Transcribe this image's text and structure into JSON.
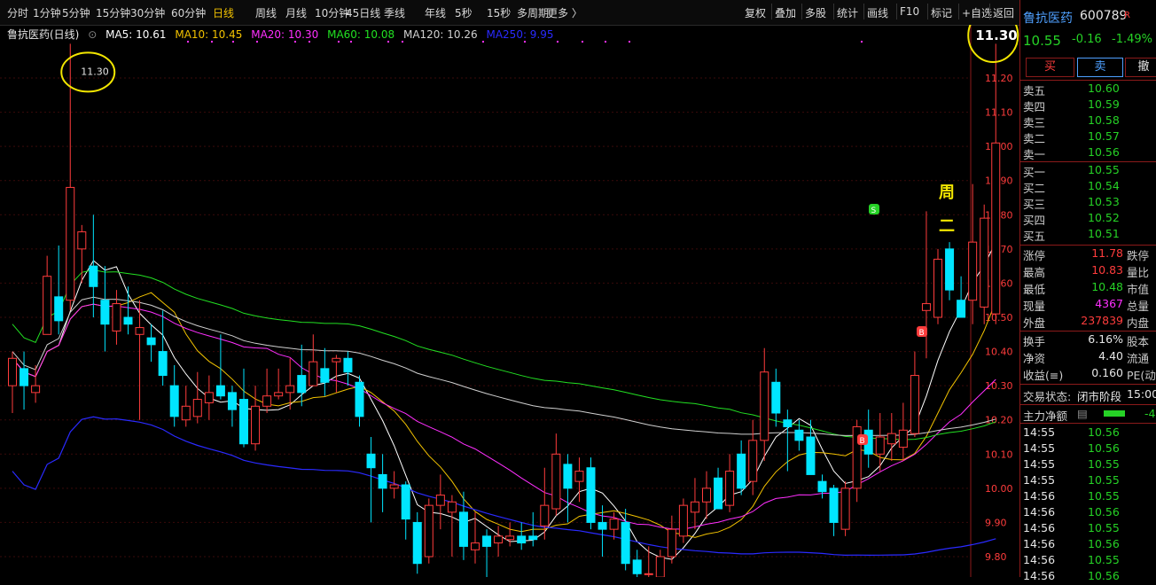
{
  "toolbar": {
    "periods": [
      "分时",
      "1分钟",
      "5分钟",
      "15分钟",
      "30分钟",
      "60分钟",
      "日线",
      "周线",
      "月线",
      "10分钟",
      "45日线",
      "季线",
      "年线",
      "5秒",
      "15秒",
      "多周期",
      "更多 〉"
    ],
    "active_period": "日线",
    "tools": [
      "复权",
      "叠加",
      "多股",
      "统计",
      "画线",
      "F10",
      "标记",
      "+自选",
      "返回"
    ]
  },
  "legend": {
    "title": "鲁抗医药(日线)",
    "ma": [
      {
        "label": "MA5: 10.61",
        "color": "#ffffff"
      },
      {
        "label": "MA10: 10.45",
        "color": "#f2c200"
      },
      {
        "label": "MA20: 10.30",
        "color": "#ff2fff"
      },
      {
        "label": "MA60: 10.08",
        "color": "#22e022"
      },
      {
        "label": "MA120: 10.26",
        "color": "#d0d0d0"
      },
      {
        "label": "MA250: 9.95",
        "color": "#2a2aff"
      }
    ]
  },
  "annotations": {
    "left_high_label": "11.30",
    "right_high_label": "11.30",
    "weekday_text": [
      "周",
      "二"
    ]
  },
  "colors": {
    "up": "#ff3c3c",
    "down": "#00e5ff",
    "grid": "#3a0a0a",
    "highlight": "#f2e600"
  },
  "chart_data": {
    "type": "candlestick",
    "price_axis": {
      "min": 9.8,
      "max": 11.2,
      "ticks": [
        "11.20",
        "11.10",
        "11.00",
        "10.90",
        "10.80",
        "10.70",
        "10.60",
        "10.50",
        "10.40",
        "10.30",
        "10.20",
        "10.10",
        "10.00",
        "9.90",
        "9.80"
      ]
    },
    "candles": [
      {
        "o": 10.3,
        "h": 10.4,
        "l": 10.22,
        "c": 10.38
      },
      {
        "o": 10.35,
        "h": 10.4,
        "l": 10.23,
        "c": 10.3
      },
      {
        "o": 10.28,
        "h": 10.36,
        "l": 10.25,
        "c": 10.3
      },
      {
        "o": 10.45,
        "h": 10.68,
        "l": 10.45,
        "c": 10.62
      },
      {
        "o": 10.56,
        "h": 10.71,
        "l": 10.45,
        "c": 10.49
      },
      {
        "o": 10.55,
        "h": 11.3,
        "l": 10.52,
        "c": 10.88
      },
      {
        "o": 10.7,
        "h": 10.77,
        "l": 10.6,
        "c": 10.75
      },
      {
        "o": 10.65,
        "h": 10.8,
        "l": 10.5,
        "c": 10.59
      },
      {
        "o": 10.55,
        "h": 10.65,
        "l": 10.4,
        "c": 10.48
      },
      {
        "o": 10.46,
        "h": 10.58,
        "l": 10.42,
        "c": 10.54
      },
      {
        "o": 10.5,
        "h": 10.59,
        "l": 10.45,
        "c": 10.48
      },
      {
        "o": 10.45,
        "h": 10.55,
        "l": 10.2,
        "c": 10.47
      },
      {
        "o": 10.44,
        "h": 10.48,
        "l": 10.37,
        "c": 10.42
      },
      {
        "o": 10.4,
        "h": 10.52,
        "l": 10.3,
        "c": 10.33
      },
      {
        "o": 10.3,
        "h": 10.36,
        "l": 10.18,
        "c": 10.21
      },
      {
        "o": 10.2,
        "h": 10.3,
        "l": 10.18,
        "c": 10.24
      },
      {
        "o": 10.21,
        "h": 10.34,
        "l": 10.19,
        "c": 10.26
      },
      {
        "o": 10.25,
        "h": 10.33,
        "l": 10.2,
        "c": 10.28
      },
      {
        "o": 10.3,
        "h": 10.45,
        "l": 10.26,
        "c": 10.27
      },
      {
        "o": 10.28,
        "h": 10.3,
        "l": 10.18,
        "c": 10.23
      },
      {
        "o": 10.26,
        "h": 10.35,
        "l": 10.12,
        "c": 10.13
      },
      {
        "o": 10.13,
        "h": 10.3,
        "l": 10.11,
        "c": 10.24
      },
      {
        "o": 10.24,
        "h": 10.35,
        "l": 10.22,
        "c": 10.27
      },
      {
        "o": 10.27,
        "h": 10.35,
        "l": 10.26,
        "c": 10.28
      },
      {
        "o": 10.28,
        "h": 10.38,
        "l": 10.23,
        "c": 10.3
      },
      {
        "o": 10.33,
        "h": 10.42,
        "l": 10.24,
        "c": 10.28
      },
      {
        "o": 10.3,
        "h": 10.45,
        "l": 10.3,
        "c": 10.37
      },
      {
        "o": 10.35,
        "h": 10.41,
        "l": 10.27,
        "c": 10.31
      },
      {
        "o": 10.37,
        "h": 10.39,
        "l": 10.28,
        "c": 10.38
      },
      {
        "o": 10.38,
        "h": 10.4,
        "l": 10.3,
        "c": 10.34
      },
      {
        "o": 10.31,
        "h": 10.33,
        "l": 10.18,
        "c": 10.21
      },
      {
        "o": 10.1,
        "h": 10.15,
        "l": 9.9,
        "c": 10.06
      },
      {
        "o": 10.04,
        "h": 10.1,
        "l": 9.93,
        "c": 10.0
      },
      {
        "o": 10.0,
        "h": 10.05,
        "l": 9.97,
        "c": 10.01
      },
      {
        "o": 10.01,
        "h": 10.02,
        "l": 9.85,
        "c": 9.91
      },
      {
        "o": 9.9,
        "h": 9.93,
        "l": 9.75,
        "c": 9.78
      },
      {
        "o": 9.8,
        "h": 9.97,
        "l": 9.78,
        "c": 9.95
      },
      {
        "o": 9.95,
        "h": 10.04,
        "l": 9.88,
        "c": 9.98
      },
      {
        "o": 9.93,
        "h": 9.98,
        "l": 9.8,
        "c": 9.96
      },
      {
        "o": 9.93,
        "h": 9.99,
        "l": 9.79,
        "c": 9.83
      },
      {
        "o": 9.82,
        "h": 9.93,
        "l": 9.78,
        "c": 9.84
      },
      {
        "o": 9.86,
        "h": 9.88,
        "l": 9.7,
        "c": 9.83
      },
      {
        "o": 9.84,
        "h": 9.89,
        "l": 9.8,
        "c": 9.86
      },
      {
        "o": 9.85,
        "h": 9.9,
        "l": 9.83,
        "c": 9.86
      },
      {
        "o": 9.86,
        "h": 9.9,
        "l": 9.82,
        "c": 9.84
      },
      {
        "o": 9.86,
        "h": 9.93,
        "l": 9.83,
        "c": 9.85
      },
      {
        "o": 9.89,
        "h": 10.06,
        "l": 9.85,
        "c": 9.95
      },
      {
        "o": 9.94,
        "h": 10.16,
        "l": 9.92,
        "c": 10.1
      },
      {
        "o": 10.07,
        "h": 10.1,
        "l": 9.9,
        "c": 10.0
      },
      {
        "o": 10.02,
        "h": 10.09,
        "l": 9.96,
        "c": 10.05
      },
      {
        "o": 10.06,
        "h": 10.09,
        "l": 9.88,
        "c": 9.9
      },
      {
        "o": 9.9,
        "h": 9.95,
        "l": 9.8,
        "c": 9.88
      },
      {
        "o": 9.88,
        "h": 9.93,
        "l": 9.85,
        "c": 9.91
      },
      {
        "o": 9.9,
        "h": 9.94,
        "l": 9.76,
        "c": 9.78
      },
      {
        "o": 9.79,
        "h": 9.82,
        "l": 9.74,
        "c": 9.75
      },
      {
        "o": 9.75,
        "h": 9.83,
        "l": 9.72,
        "c": 9.75
      },
      {
        "o": 9.74,
        "h": 9.82,
        "l": 9.72,
        "c": 9.8
      },
      {
        "o": 9.8,
        "h": 9.92,
        "l": 9.78,
        "c": 9.88
      },
      {
        "o": 9.86,
        "h": 9.97,
        "l": 9.84,
        "c": 9.95
      },
      {
        "o": 9.93,
        "h": 10.03,
        "l": 9.88,
        "c": 9.96
      },
      {
        "o": 9.96,
        "h": 10.05,
        "l": 9.91,
        "c": 10.0
      },
      {
        "o": 10.03,
        "h": 10.06,
        "l": 9.96,
        "c": 9.94
      },
      {
        "o": 9.95,
        "h": 10.1,
        "l": 9.93,
        "c": 10.05
      },
      {
        "o": 10.1,
        "h": 10.14,
        "l": 9.98,
        "c": 10.0
      },
      {
        "o": 10.02,
        "h": 10.2,
        "l": 9.98,
        "c": 10.14
      },
      {
        "o": 10.14,
        "h": 10.41,
        "l": 10.08,
        "c": 10.34
      },
      {
        "o": 10.31,
        "h": 10.35,
        "l": 10.18,
        "c": 10.22
      },
      {
        "o": 10.2,
        "h": 10.23,
        "l": 10.05,
        "c": 10.18
      },
      {
        "o": 10.17,
        "h": 10.2,
        "l": 10.11,
        "c": 10.14
      },
      {
        "o": 10.15,
        "h": 10.2,
        "l": 10.04,
        "c": 10.04
      },
      {
        "o": 10.02,
        "h": 10.04,
        "l": 9.97,
        "c": 9.99
      },
      {
        "o": 10.0,
        "h": 10.01,
        "l": 9.86,
        "c": 9.9
      },
      {
        "o": 9.88,
        "h": 10.02,
        "l": 9.86,
        "c": 10.0
      },
      {
        "o": 10.0,
        "h": 10.2,
        "l": 9.96,
        "c": 10.18
      },
      {
        "o": 10.17,
        "h": 10.23,
        "l": 10.06,
        "c": 10.1
      },
      {
        "o": 10.1,
        "h": 10.22,
        "l": 10.05,
        "c": 10.15
      },
      {
        "o": 10.13,
        "h": 10.22,
        "l": 10.08,
        "c": 10.16
      },
      {
        "o": 10.12,
        "h": 10.25,
        "l": 10.08,
        "c": 10.17
      },
      {
        "o": 10.16,
        "h": 10.4,
        "l": 10.15,
        "c": 10.33
      },
      {
        "o": 10.52,
        "h": 10.81,
        "l": 10.38,
        "c": 10.54
      },
      {
        "o": 10.5,
        "h": 10.7,
        "l": 10.48,
        "c": 10.67
      },
      {
        "o": 10.7,
        "h": 10.72,
        "l": 10.55,
        "c": 10.58
      },
      {
        "o": 10.55,
        "h": 10.62,
        "l": 10.5,
        "c": 10.5
      },
      {
        "o": 10.55,
        "h": 10.89,
        "l": 10.48,
        "c": 10.72
      },
      {
        "o": 10.53,
        "h": 10.83,
        "l": 10.48,
        "c": 10.79
      },
      {
        "o": 10.51,
        "h": 11.3,
        "l": 10.48,
        "c": 11.01
      }
    ]
  },
  "stock_panel": {
    "name": "鲁抗医药",
    "code": "600789",
    "badge": "R",
    "price": "10.55",
    "change": "-0.16",
    "change_pct": "-1.49%",
    "buttons": [
      "买",
      "卖",
      "撤"
    ],
    "sell_levels": [
      {
        "label": "卖五",
        "price": "10.60"
      },
      {
        "label": "卖四",
        "price": "10.59"
      },
      {
        "label": "卖三",
        "price": "10.58"
      },
      {
        "label": "卖二",
        "price": "10.57"
      },
      {
        "label": "卖一",
        "price": "10.56"
      }
    ],
    "buy_levels": [
      {
        "label": "买一",
        "price": "10.55"
      },
      {
        "label": "买二",
        "price": "10.54"
      },
      {
        "label": "买三",
        "price": "10.53"
      },
      {
        "label": "买四",
        "price": "10.52"
      },
      {
        "label": "买五",
        "price": "10.51"
      }
    ],
    "stats": [
      {
        "label": "涨停",
        "value": "11.78",
        "label2": "跌停",
        "color": "#ff3c3c"
      },
      {
        "label": "最高",
        "value": "10.83",
        "label2": "量比",
        "color": "#ff3c3c"
      },
      {
        "label": "最低",
        "value": "10.48",
        "label2": "市值",
        "color": "#26d226"
      },
      {
        "label": "现量",
        "value": "4367",
        "label2": "总量",
        "color": "#ff2fff"
      },
      {
        "label": "外盘",
        "value": "237839",
        "label2": "内盘",
        "color": "#ff3c3c"
      }
    ],
    "stats2": [
      {
        "label": "换手",
        "value": "6.16%",
        "label2": "股本"
      },
      {
        "label": "净资",
        "value": "4.40",
        "label2": "流通"
      },
      {
        "label": "收益(≡)",
        "value": "0.160",
        "label2": "PE(动"
      }
    ],
    "trade_status_label": "交易状态:",
    "trade_status": "闭市阶段",
    "trade_time": "15:00",
    "main_flow_label": "主力净额",
    "main_flow_value": "-4",
    "ticks": [
      {
        "time": "14:55",
        "price": "10.56"
      },
      {
        "time": "14:55",
        "price": "10.56"
      },
      {
        "time": "14:55",
        "price": "10.55"
      },
      {
        "time": "14:55",
        "price": "10.55"
      },
      {
        "time": "14:56",
        "price": "10.55"
      },
      {
        "time": "14:56",
        "price": "10.56"
      },
      {
        "time": "14:56",
        "price": "10.55"
      },
      {
        "time": "14:56",
        "price": "10.56"
      },
      {
        "time": "14:56",
        "price": "10.55"
      },
      {
        "time": "14:56",
        "price": "10.56"
      }
    ]
  }
}
